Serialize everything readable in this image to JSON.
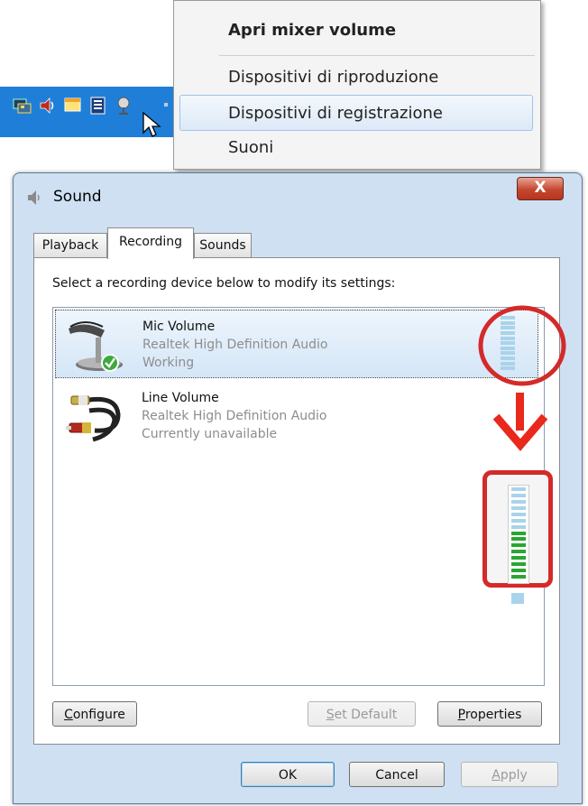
{
  "tray": {
    "icons": [
      "network-icon",
      "speaker-icon",
      "window-icon",
      "battery-icon",
      "mic-tray-icon"
    ]
  },
  "context_menu": {
    "items": [
      {
        "label": "Apri mixer volume",
        "bold": true
      },
      {
        "label": "Dispositivi di riproduzione"
      },
      {
        "label": "Dispositivi di registrazione",
        "highlighted": true
      },
      {
        "label": "Suoni"
      }
    ]
  },
  "window": {
    "title": "Sound",
    "close_glyph": "X",
    "tabs": [
      "Playback",
      "Recording",
      "Sounds"
    ],
    "active_tab": "Recording",
    "instructions": "Select a recording device below to modify its settings:",
    "devices": [
      {
        "name": "Mic Volume",
        "driver": "Realtek High Definition Audio",
        "status": "Working",
        "default": true,
        "selected": true,
        "level": 0
      },
      {
        "name": "Line Volume",
        "driver": "Realtek High Definition Audio",
        "status": "Currently unavailable",
        "default": false,
        "selected": false
      }
    ],
    "annotation": {
      "meter_after_level": 0.5,
      "circle_color": "#d42a2a",
      "arrow_color": "#e8291c"
    },
    "buttons": {
      "configure": {
        "prefix": "",
        "accel": "C",
        "rest": "onfigure"
      },
      "set_default": {
        "prefix": "",
        "accel": "S",
        "rest": "et Default"
      },
      "properties": {
        "prefix": "",
        "accel": "P",
        "rest": "roperties"
      },
      "ok": "OK",
      "cancel": "Cancel",
      "apply": {
        "prefix": "",
        "accel": "A",
        "rest": "pply"
      }
    }
  },
  "colors": {
    "taskbar": "#1f7fd8",
    "meter_idle": "#a9d3ea",
    "meter_active": "#2aa632"
  }
}
